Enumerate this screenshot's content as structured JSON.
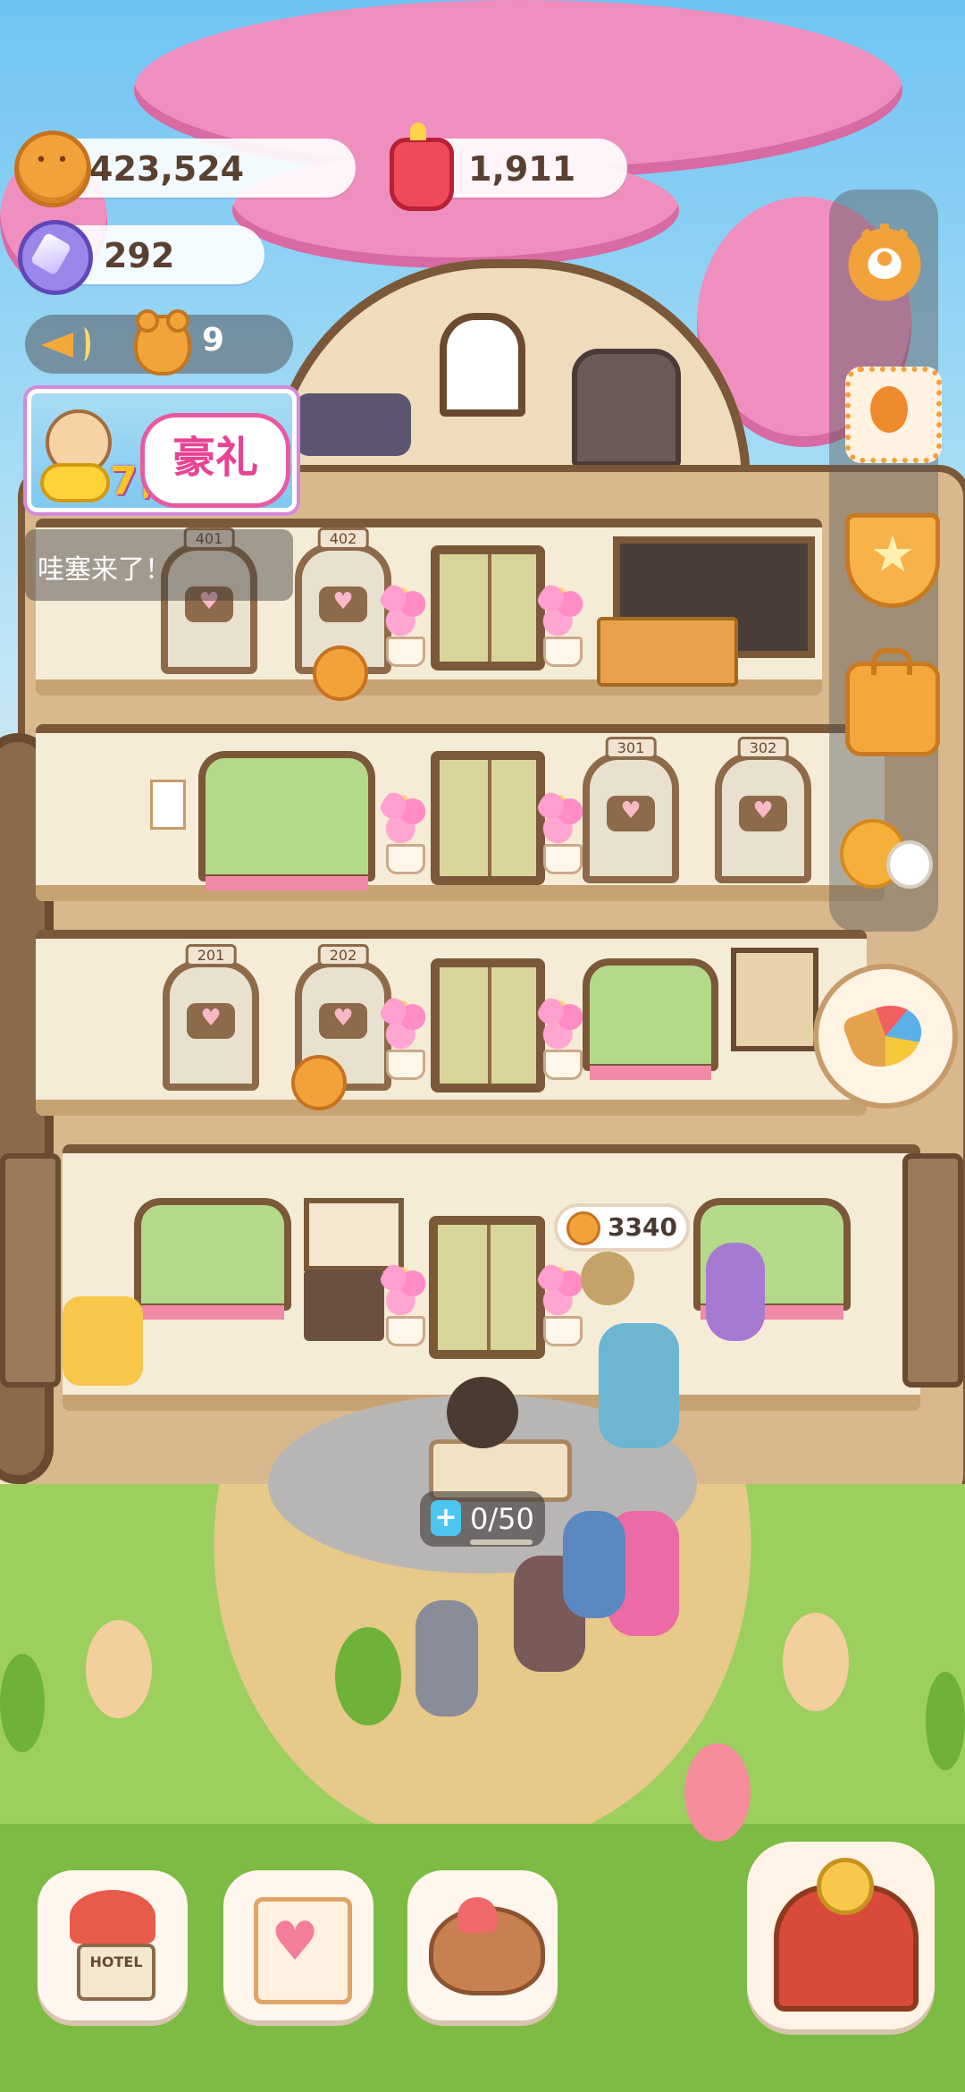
{
  "resources": {
    "coins": "423,524",
    "rubies": "1,911",
    "gems": "292",
    "guest_count": "9"
  },
  "event_banner": {
    "days": "7日",
    "title": "豪礼"
  },
  "chat": {
    "message": "哇塞来了！"
  },
  "rooms": {
    "floor4": [
      "401",
      "402"
    ],
    "floor3": [
      "301",
      "302"
    ],
    "floor2": [
      "201",
      "202"
    ]
  },
  "lobby": {
    "tip_amount": "3340"
  },
  "energy": {
    "value": "0/50",
    "fill": 0
  },
  "dock": {
    "hotel_sign": "HOTEL"
  },
  "colors": {
    "coin": "#f2a23a",
    "ruby": "#ef4a5a",
    "gem": "#9b86ea",
    "blossom": "#ef8fbf",
    "grass": "#9ccf5e"
  },
  "icons": {
    "settings": "gear-icon",
    "stamp": "stamp-icon",
    "medal": "medal-icon",
    "bag": "bag-icon",
    "friends": "friends-icon",
    "crepe": "crepe-icon",
    "hotel": "hotel-icon",
    "diary": "diary-icon",
    "cake": "cake-icon",
    "gacha": "gacha-icon",
    "announcement": "megaphone-icon"
  }
}
